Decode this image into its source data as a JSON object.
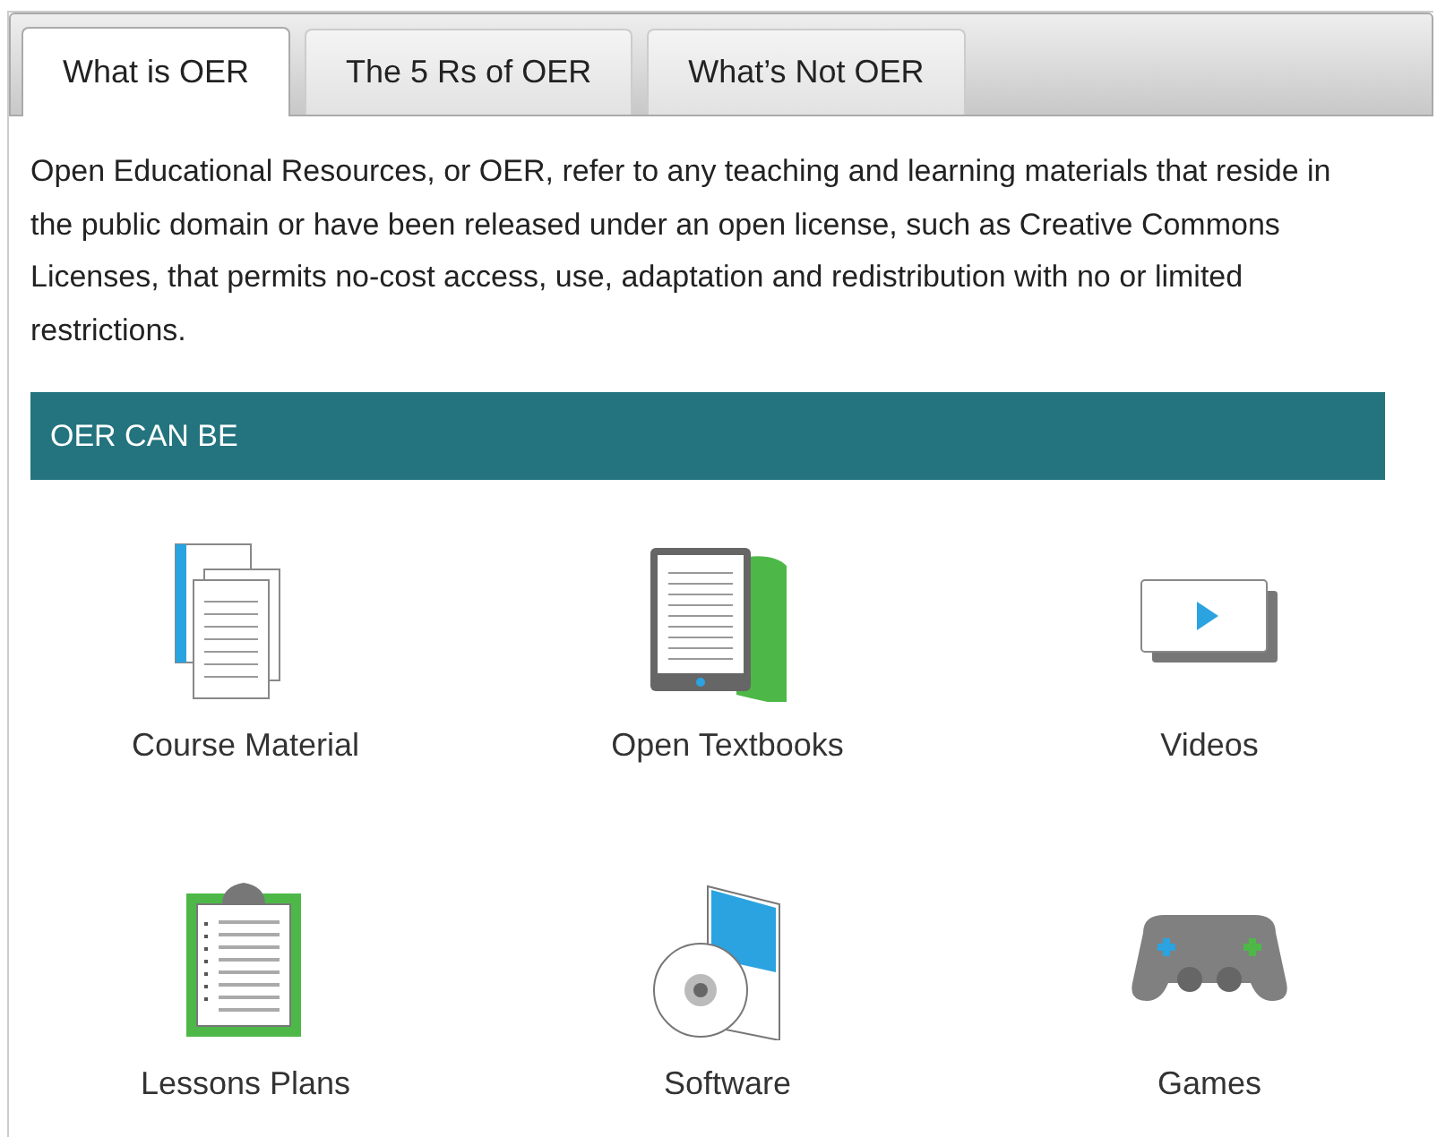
{
  "tabs": [
    {
      "label": "What is OER",
      "selected": true
    },
    {
      "label": "The 5 Rs of OER",
      "selected": false
    },
    {
      "label": "What’s Not OER",
      "selected": false
    }
  ],
  "intro": "Open Educational Resources, or OER, refer to any teaching and learning materials that reside in the public domain or have been released under an open license, such as Creative Commons Licenses, that permits no-cost access, use, adaptation and redistribution with no or limited restrictions.",
  "section_heading": "OER CAN BE",
  "items": [
    {
      "kind": "documents",
      "label": "Course Material"
    },
    {
      "kind": "textbook",
      "label": "Open Textbooks"
    },
    {
      "kind": "video",
      "label": "Videos"
    },
    {
      "kind": "clipboard",
      "label": "Lessons Plans"
    },
    {
      "kind": "software",
      "label": "Software"
    },
    {
      "kind": "gamepad",
      "label": "Games"
    }
  ]
}
